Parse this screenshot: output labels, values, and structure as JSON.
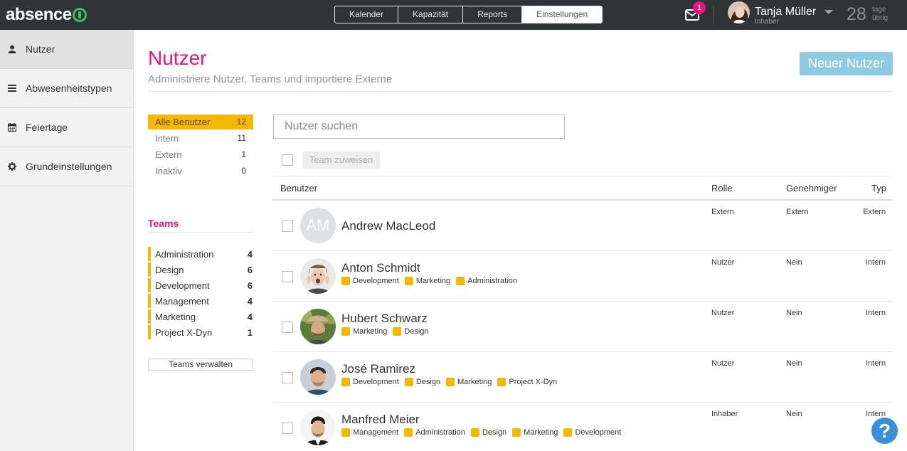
{
  "brand": {
    "logo_text": "absence"
  },
  "main_nav": [
    {
      "label": "Kalender",
      "active": false
    },
    {
      "label": "Kapazität",
      "active": false
    },
    {
      "label": "Reports",
      "active": false
    },
    {
      "label": "Einstellungen",
      "active": true
    }
  ],
  "header_user": {
    "mail_badge": "1",
    "name": "Tanja Müller",
    "role": "Inhaber",
    "days_left": "28",
    "days_label": "tage übrig"
  },
  "sidebar": {
    "items": [
      {
        "label": "Nutzer",
        "icon": "user-icon",
        "active": true
      },
      {
        "label": "Abwesenheitstypen",
        "icon": "list-icon",
        "active": false
      },
      {
        "label": "Feiertage",
        "icon": "calendar-icon",
        "active": false
      },
      {
        "label": "Grundeinstellungen",
        "icon": "gear-icon",
        "active": false
      }
    ]
  },
  "page": {
    "title": "Nutzer",
    "subtitle": "Administriere Nutzer, Teams und importiere Externe",
    "new_button": "Neuer Nutzer"
  },
  "filters": [
    {
      "label": "Alle Benutzer",
      "count": "12",
      "active": true
    },
    {
      "label": "Intern",
      "count": "11",
      "active": false
    },
    {
      "label": "Extern",
      "count": "1",
      "active": false
    },
    {
      "label": "Inaktiv",
      "count": "0",
      "active": false
    }
  ],
  "teams": {
    "title": "Teams",
    "items": [
      {
        "label": "Administration",
        "count": "4"
      },
      {
        "label": "Design",
        "count": "6"
      },
      {
        "label": "Development",
        "count": "6"
      },
      {
        "label": "Management",
        "count": "4"
      },
      {
        "label": "Marketing",
        "count": "4"
      },
      {
        "label": "Project X-Dyn",
        "count": "1"
      }
    ],
    "manage_button": "Teams verwalten"
  },
  "search": {
    "placeholder": "Nutzer suchen",
    "value": ""
  },
  "toolbar": {
    "assign_team": "Team zuweisen"
  },
  "table": {
    "headers": {
      "user": "Benutzer",
      "role": "Rolle",
      "approver": "Genehmiger",
      "type": "Typ"
    },
    "rows": [
      {
        "name": "Andrew MacLeod",
        "initials": "AM",
        "tags": [],
        "role": "Extern",
        "approver": "Extern",
        "type": "Extern"
      },
      {
        "name": "Anton Schmidt",
        "tags": [
          "Development",
          "Marketing",
          "Administration"
        ],
        "role": "Nutzer",
        "approver": "Nein",
        "type": "Intern"
      },
      {
        "name": "Hubert Schwarz",
        "tags": [
          "Marketing",
          "Design"
        ],
        "role": "Nutzer",
        "approver": "Nein",
        "type": "Intern"
      },
      {
        "name": "José Ramirez",
        "tags": [
          "Development",
          "Design",
          "Marketing",
          "Project X-Dyn"
        ],
        "role": "Nutzer",
        "approver": "Nein",
        "type": "Intern"
      },
      {
        "name": "Manfred Meier",
        "tags": [
          "Management",
          "Administration",
          "Design",
          "Marketing",
          "Development"
        ],
        "role": "Inhaber",
        "approver": "Nein",
        "type": "Intern"
      }
    ]
  },
  "help": {
    "label": "?"
  },
  "colors": {
    "accent_pink": "#e8147c",
    "team_yellow": "#f5b800",
    "topbar": "#2f3537",
    "button_blue": "#8ecbe3"
  }
}
